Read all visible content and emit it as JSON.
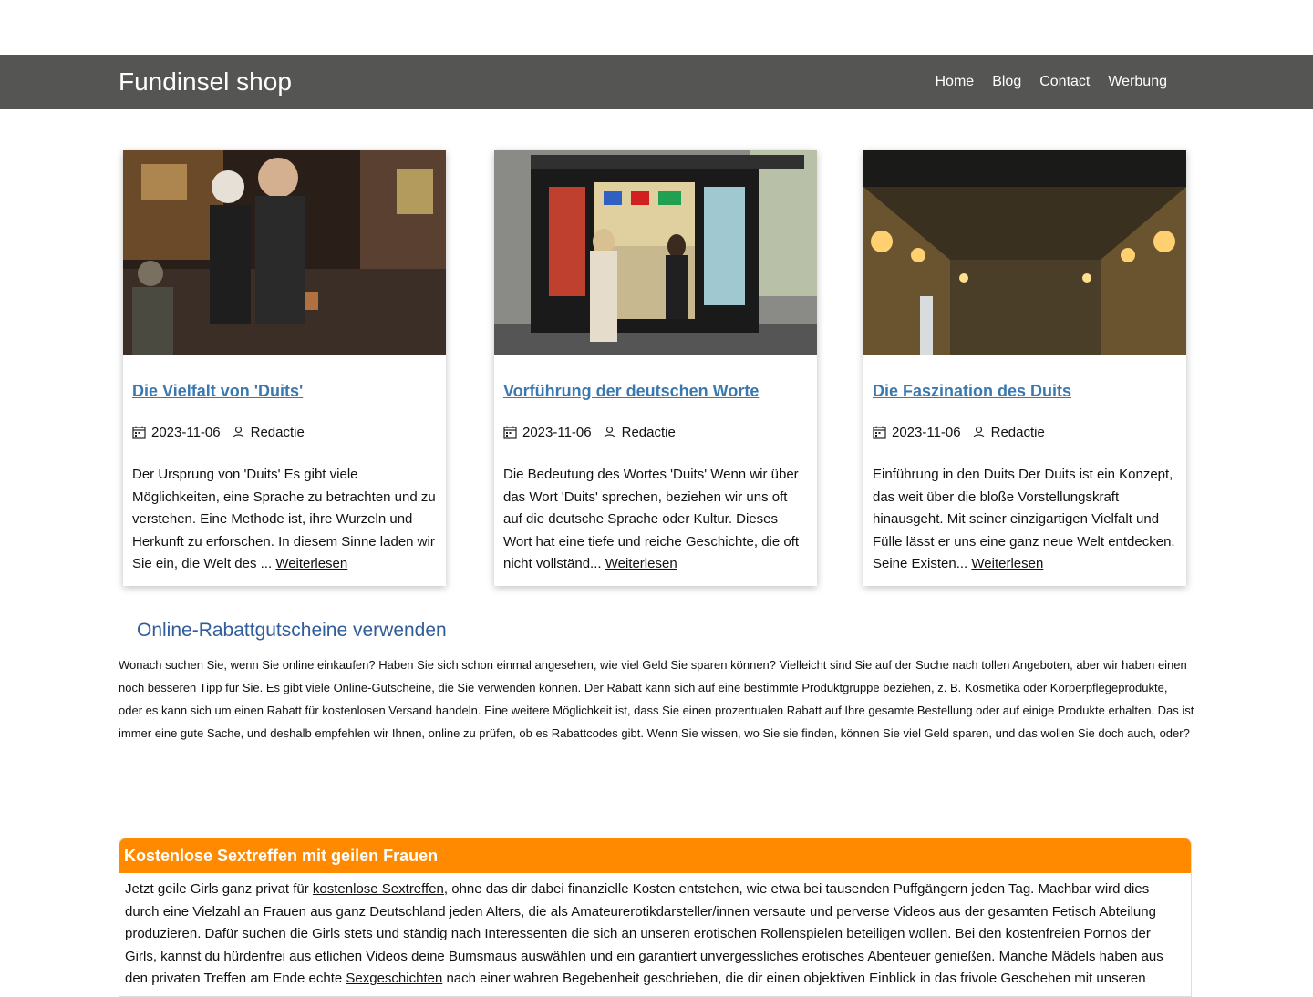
{
  "site": {
    "brand": "Fundinsel shop"
  },
  "nav": {
    "items": [
      "Home",
      "Blog",
      "Contact",
      "Werbung"
    ]
  },
  "posts": [
    {
      "title": "Die Vielfalt von 'Duits'",
      "date": "2023-11-06",
      "author": "Redactie",
      "excerpt": "Der Ursprung von 'Duits' Es gibt viele Möglichkeiten, eine Sprache zu betrachten und zu verstehen. Eine Methode ist, ihre Wurzeln und Herkunft zu erforschen. In diesem Sinne laden wir Sie ein, die Welt des ... ",
      "read_more": "Weiterlesen"
    },
    {
      "title": "Vorführung der deutschen Worte",
      "date": "2023-11-06",
      "author": "Redactie",
      "excerpt": "Die Bedeutung des Wortes 'Duits' Wenn wir über das Wort 'Duits' sprechen, beziehen wir uns oft auf die deutsche Sprache oder Kultur. Dieses Wort hat eine tiefe und reiche Geschichte, die oft nicht vollständ... ",
      "read_more": "Weiterlesen"
    },
    {
      "title": "Die Faszination des Duits",
      "date": "2023-11-06",
      "author": "Redactie",
      "excerpt": "Einführung in den Duits Der Duits ist ein Konzept, das weit über die bloße Vorstellungskraft hinausgeht. Mit seiner einzigartigen Vielfalt und Fülle lässt er uns eine ganz neue Welt entdecken. Seine Existen... ",
      "read_more": "Weiterlesen"
    }
  ],
  "coupon": {
    "heading": "Online-Rabattgutscheine verwenden",
    "text": "Wonach suchen Sie, wenn Sie online einkaufen? Haben Sie sich schon einmal angesehen, wie viel Geld Sie sparen können? Vielleicht sind Sie auf der Suche nach tollen Angeboten, aber wir haben einen noch besseren Tipp für Sie. Es gibt viele Online-Gutscheine, die Sie verwenden können. Der Rabatt kann sich auf eine bestimmte Produktgruppe beziehen, z. B. Kosmetika oder Körperpflegeprodukte, oder es kann sich um einen Rabatt für kostenlosen Versand handeln. Eine weitere Möglichkeit ist, dass Sie einen prozentualen Rabatt auf Ihre gesamte Bestellung oder auf einige Produkte erhalten. Das ist immer eine gute Sache, und deshalb empfehlen wir Ihnen, online zu prüfen, ob es Rabattcodes gibt. Wenn Sie wissen, wo Sie sie finden, können Sie viel Geld sparen, und das wollen Sie doch auch, oder?"
  },
  "promo": {
    "heading": "Kostenlose Sextreffen mit geilen Frauen",
    "text_1": "Jetzt geile Girls ganz privat für ",
    "link_1": "kostenlose Sextreffen",
    "text_2": ", ohne das dir dabei finanzielle Kosten entstehen, wie etwa bei tausenden Puffgängern jeden Tag. Machbar wird dies durch eine Vielzahl an Frauen aus ganz Deutschland jeden Alters, die als Amateurerotikdarsteller/innen versaute und perverse Videos aus der gesamten Fetisch Abteilung produzieren. Dafür suchen die Girls stets und ständig nach Interessenten die sich an unseren erotischen Rollenspielen beteiligen wollen. Bei den kostenfreien Pornos der Girls, kannst du hürdenfrei aus etlichen Videos deine Bumsmaus auswählen und ein garantiert unvergessliches erotisches Abenteuer genießen. Manche Mädels haben aus den privaten Treffen am Ende echte ",
    "link_2": "Sexgeschichten",
    "text_3": " nach einer wahren Begebenheit geschrieben, die dir einen objektiven Einblick in das frivole Geschehen mit unseren"
  },
  "colors": {
    "navbar": "#555553",
    "link": "#3a78b0",
    "accent": "#ff8a00",
    "heading": "#2f5d9a"
  }
}
